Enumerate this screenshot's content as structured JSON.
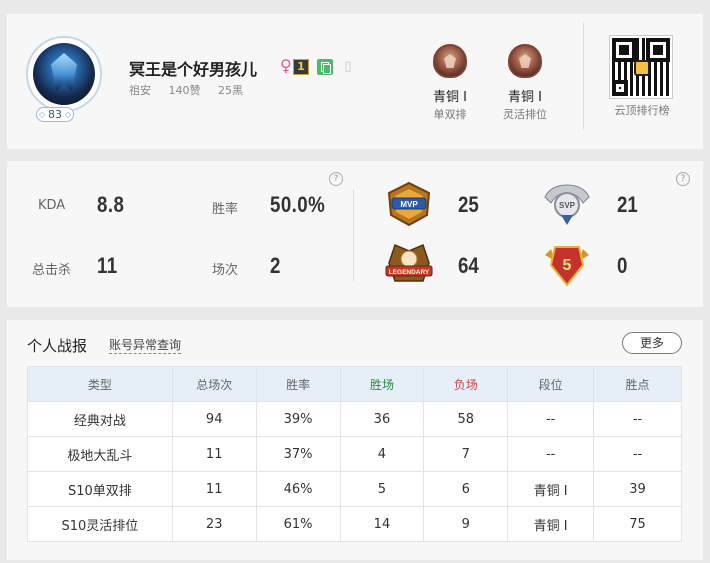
{
  "profile": {
    "name": "冥王是个好男孩儿",
    "gender_symbol": "♀",
    "rank_badge": "1",
    "level": "83",
    "region": "祖安",
    "likes": "140赞",
    "blacks": "25黑",
    "icons": [
      "female-icon",
      "top-rank-icon",
      "copy-icon",
      "device-icon"
    ]
  },
  "ranks": [
    {
      "tier": "青铜 Ⅰ",
      "queue": "单双排"
    },
    {
      "tier": "青铜 Ⅰ",
      "queue": "灵活排位"
    }
  ],
  "qr": {
    "caption": "云顶排行榜"
  },
  "stats": {
    "kda_label": "KDA",
    "kda_value": "8.8",
    "kills_label": "总击杀",
    "kills_value": "11",
    "winrate_label": "胜率",
    "winrate_value": "50.0%",
    "games_label": "场次",
    "games_value": "2",
    "help": "?"
  },
  "medals": [
    {
      "icon": "mvp-medal-icon",
      "text": "MVP",
      "count": "25"
    },
    {
      "icon": "svp-medal-icon",
      "text": "SVP",
      "count": "21"
    },
    {
      "icon": "legendary-medal-icon",
      "text": "LEGENDARY",
      "count": "64"
    },
    {
      "icon": "pentakill-medal-icon",
      "text": "5",
      "count": "0"
    }
  ],
  "report": {
    "title": "个人战报",
    "link": "账号异常查询",
    "more": "更多",
    "headers": [
      "类型",
      "总场次",
      "胜率",
      "胜场",
      "负场",
      "段位",
      "胜点"
    ],
    "rows": [
      [
        "经典对战",
        "94",
        "39%",
        "36",
        "58",
        "--",
        "--"
      ],
      [
        "极地大乱斗",
        "11",
        "37%",
        "4",
        "7",
        "--",
        "--"
      ],
      [
        "S10单双排",
        "11",
        "46%",
        "5",
        "6",
        "青铜 Ⅰ",
        "39"
      ],
      [
        "S10灵活排位",
        "23",
        "61%",
        "14",
        "9",
        "青铜 Ⅰ",
        "75"
      ]
    ]
  },
  "colors": {
    "win": "#2a8a3e",
    "lose": "#d8413d",
    "female": "#e0569a",
    "header_bg": "#e6eef8"
  }
}
